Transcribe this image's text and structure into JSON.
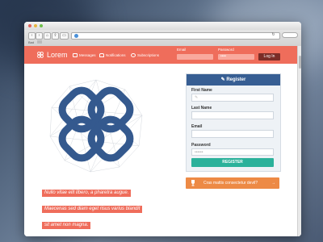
{
  "browser": {
    "back_label": "‹",
    "forward_label": "›",
    "reload_label": "↻",
    "bookmarks_label": "Bad"
  },
  "site": {
    "logo": "Lorem",
    "nav": [
      {
        "label": "Messages",
        "icon": "chat-icon"
      },
      {
        "label": "Notifications",
        "icon": "bell-icon"
      },
      {
        "label": "Subscriptions",
        "icon": "user-icon"
      }
    ],
    "login": {
      "email_label": "Email",
      "password_label": "Password",
      "password_value": "••••",
      "button": "Log In"
    }
  },
  "captions": [
    "Nullo vitae elit libero, a pharetra augue.",
    "Maecenas sed diam eget risus varius blandit",
    "sit amet non magna."
  ],
  "register": {
    "title": "Register",
    "fields": [
      {
        "label": "First Name",
        "value": ""
      },
      {
        "label": "Last Name",
        "value": ""
      },
      {
        "label": "Email",
        "value": ""
      },
      {
        "label": "Password",
        "value": "••••••"
      }
    ],
    "button": "REGISTER"
  },
  "cta": {
    "label": "Cras mattis consectetur devil?",
    "arrow": "→"
  },
  "colors": {
    "accent": "#ef6d5b",
    "register_header": "#375e93",
    "register_button": "#2bb19a",
    "cta": "#ed8a45",
    "logo_blue": "#34598e"
  }
}
